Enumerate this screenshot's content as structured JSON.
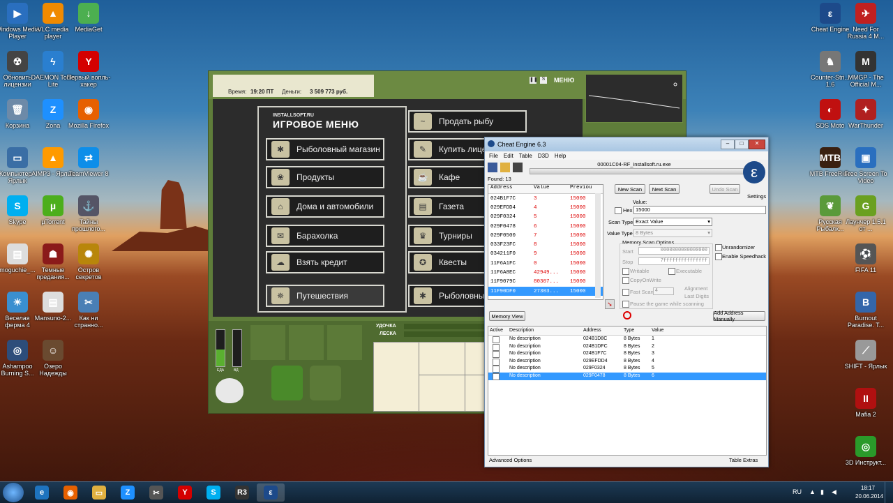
{
  "desktop": {
    "left_icons": [
      {
        "label": "Windows Media Player",
        "glyph": "▶",
        "color": "#2a6fbf",
        "icon": "media-player-icon"
      },
      {
        "label": "VLC media player",
        "glyph": "▲",
        "color": "#f08a00",
        "icon": "vlc-icon"
      },
      {
        "label": "MediaGet",
        "glyph": "↓",
        "color": "#4caf50",
        "icon": "mediaget-icon"
      },
      {
        "label": "Обновить лицензии",
        "glyph": "☢",
        "color": "#444",
        "icon": "update-icon"
      },
      {
        "label": "DAEMON Tools Lite",
        "glyph": "ϟ",
        "color": "#2a7fd0",
        "icon": "daemon-icon"
      },
      {
        "label": "Первый вопль-хакер",
        "glyph": "Y",
        "color": "#d40000",
        "icon": "yandex-icon"
      },
      {
        "label": "Корзина",
        "glyph": "🗑",
        "color": "#6d8aa8",
        "icon": "recycle-bin-icon"
      },
      {
        "label": "Zona",
        "glyph": "Z",
        "color": "#1e90ff",
        "icon": "zona-icon"
      },
      {
        "label": "Mozilla Firefox",
        "glyph": "◉",
        "color": "#e66000",
        "icon": "firefox-icon"
      },
      {
        "label": "Компьютер - Ярлык",
        "glyph": "▭",
        "color": "#3a6ea5",
        "icon": "computer-icon"
      },
      {
        "label": "AIMP3 - Ярлык",
        "glyph": "▲",
        "color": "#ff9a00",
        "icon": "aimp-icon"
      },
      {
        "label": "TeamViewer 8",
        "glyph": "⇄",
        "color": "#0e8ee9",
        "icon": "teamviewer-icon"
      },
      {
        "label": "Skype",
        "glyph": "S",
        "color": "#00aff0",
        "icon": "skype-icon"
      },
      {
        "label": "µTorrent",
        "glyph": "µ",
        "color": "#4cae1c",
        "icon": "utorrent-icon"
      },
      {
        "label": "Тайны прошлого...",
        "glyph": "⚓",
        "color": "#556",
        "icon": "game-icon"
      },
      {
        "label": "moguchie_...",
        "glyph": "▤",
        "color": "#ddd",
        "icon": "document-icon"
      },
      {
        "label": "Темные предания...",
        "glyph": "☗",
        "color": "#8b1a1a",
        "icon": "game-icon"
      },
      {
        "label": "Остров секретов",
        "glyph": "✺",
        "color": "#b8860b",
        "icon": "game-icon"
      },
      {
        "label": "Веселая ферма 4",
        "glyph": "☀",
        "color": "#3a8fd0",
        "icon": "game-icon"
      },
      {
        "label": "Mansuno-2...",
        "glyph": "▤",
        "color": "#ddd",
        "icon": "document-icon"
      },
      {
        "label": "Как ни странно...",
        "glyph": "✂",
        "color": "#4a7fb5",
        "icon": "game-icon"
      },
      {
        "label": "Ashampoo Burning S...",
        "glyph": "◎",
        "color": "#2d4d7a",
        "icon": "ashampoo-icon"
      },
      {
        "label": "Озеро Надежды",
        "glyph": "☺",
        "color": "#6a4a30",
        "icon": "game-icon"
      }
    ],
    "right_icons": [
      {
        "label": "Cheat Engine",
        "glyph": "ε",
        "color": "#1d4a8a",
        "icon": "cheat-engine-icon"
      },
      {
        "label": "Need For Russia 4 M...",
        "glyph": "✈",
        "color": "#c02020",
        "icon": "game-icon"
      },
      {
        "label": "Counter-Stri... 1.6",
        "glyph": "♞",
        "color": "#777",
        "icon": "counter-strike-icon"
      },
      {
        "label": "MMGP - The Official M...",
        "glyph": "M",
        "color": "#333",
        "icon": "game-icon"
      },
      {
        "label": "SDS Moto",
        "glyph": "◐",
        "color": "#c01010",
        "icon": "game-icon"
      },
      {
        "label": "WarThunder",
        "glyph": "✦",
        "color": "#b02020",
        "icon": "warthunder-icon"
      },
      {
        "label": "MTB FreeRide",
        "glyph": "MTB",
        "color": "#3a2010",
        "icon": "game-icon"
      },
      {
        "label": "Free Screen To Video",
        "glyph": "▣",
        "color": "#2a6fbf",
        "icon": "screen-video-icon"
      },
      {
        "label": "Русская Рыбалк...",
        "glyph": "❦",
        "color": "#5a9a3a",
        "icon": "fishing-icon"
      },
      {
        "label": "Лаунчер 1.5.1 от ...",
        "glyph": "G",
        "color": "#6aa020",
        "icon": "launcher-icon"
      },
      {
        "label": "FIFA 11",
        "glyph": "⚽",
        "color": "#555",
        "icon": "fifa-icon"
      },
      {
        "label": "Burnout Paradise. T...",
        "glyph": "B",
        "color": "#3366aa",
        "icon": "game-icon"
      },
      {
        "label": "SHIFT - Ярлык",
        "glyph": "⟋",
        "color": "#999",
        "icon": "shift-icon"
      },
      {
        "label": "Mafia 2",
        "glyph": "II",
        "color": "#b01010",
        "icon": "mafia-icon"
      },
      {
        "label": "3D Инструкт...",
        "glyph": "◎",
        "color": "#2a9a2a",
        "icon": "game-icon"
      }
    ]
  },
  "game": {
    "time_label": "Время:",
    "time_value": "19:20 ПТ",
    "money_label": "Деньги:",
    "money_value": "3 509 773 руб.",
    "menu_label": "МЕНЮ",
    "logo_small": "INSTALLSOFT.RU",
    "logo_big": "ИГРОВОЕ МЕНЮ",
    "left_buttons": [
      "Рыболовный магазин",
      "Продукты",
      "Дома и автомобили",
      "Барахолка",
      "Взять кредит",
      "Путешествия"
    ],
    "right_buttons": [
      "Продать рыбу",
      "Купить лицензию",
      "Кафе",
      "Газета",
      "Турниры",
      "Квесты",
      "Рыболовные"
    ],
    "bar_labels": {
      "eda": "ЕДА",
      "vd": "ВД",
      "udochka": "УДОЧКА",
      "leska": "ЛЕСКА"
    }
  },
  "ce": {
    "title": "Cheat Engine 6.3",
    "menu": [
      "File",
      "Edit",
      "Table",
      "D3D",
      "Help"
    ],
    "process": "00001C04-RF_installsoft.ru.exe",
    "found": "Found: 13",
    "columns": [
      "Address",
      "Value",
      "Previou"
    ],
    "rows": [
      {
        "address": "024B1F7C",
        "value": "3",
        "previous": "15000"
      },
      {
        "address": "029EFDD4",
        "value": "4",
        "previous": "15000"
      },
      {
        "address": "029F0324",
        "value": "5",
        "previous": "15000"
      },
      {
        "address": "029F0478",
        "value": "6",
        "previous": "15000"
      },
      {
        "address": "029F0500",
        "value": "7",
        "previous": "15000"
      },
      {
        "address": "033F23FC",
        "value": "8",
        "previous": "15000"
      },
      {
        "address": "034211F0",
        "value": "9",
        "previous": "15000"
      },
      {
        "address": "11F6A1FC",
        "value": "0",
        "previous": "15000"
      },
      {
        "address": "11F6A8EC",
        "value": "42949...",
        "previous": "15000"
      },
      {
        "address": "11F9079C",
        "value": "80307...",
        "previous": "15000"
      },
      {
        "address": "11F90DF0",
        "value": "27303...",
        "previous": "15000"
      }
    ],
    "new_scan": "New Scan",
    "next_scan": "Next Scan",
    "undo_scan": "Undo Scan",
    "settings": "Settings",
    "value_label": "Value:",
    "hex_label": "Hex",
    "value_input": "15000",
    "scan_type_label": "Scan Type",
    "scan_type": "Exact Value",
    "value_type_label": "Value Type",
    "value_type": "8 Bytes",
    "memory_options": "Memory Scan Options",
    "start_label": "Start",
    "start_value": "0000000000000000",
    "stop_label": "Stop",
    "stop_value": "7fffffffffffffff",
    "writable": "Writable",
    "executable": "Executable",
    "copyonwrite": "CopyOnWrite",
    "fast_scan": "Fast Scan",
    "fast_scan_value": "4",
    "alignment": "Alignment",
    "last_digits": "Last Digits",
    "pause_game": "Pause the game while scanning",
    "unrandomizer": "Unrandomizer",
    "speedhack": "Enable Speedhack",
    "memory_view": "Memory View",
    "add_manual": "Add Address Manually",
    "table_columns": [
      "Active",
      "Description",
      "Address",
      "Type",
      "Value"
    ],
    "table_rows": [
      {
        "desc": "No description",
        "address": "024B1D8C",
        "type": "8 Bytes",
        "value": "1"
      },
      {
        "desc": "No description",
        "address": "024B1DFC",
        "type": "8 Bytes",
        "value": "2"
      },
      {
        "desc": "No description",
        "address": "024B1F7C",
        "type": "8 Bytes",
        "value": "3"
      },
      {
        "desc": "No description",
        "address": "029EFDD4",
        "type": "8 Bytes",
        "value": "4"
      },
      {
        "desc": "No description",
        "address": "029F0324",
        "type": "8 Bytes",
        "value": "5"
      },
      {
        "desc": "No description",
        "address": "029F0478",
        "type": "8 Bytes",
        "value": "6"
      }
    ],
    "advanced": "Advanced Options",
    "table_extras": "Table Extras"
  },
  "taskbar": {
    "items": [
      {
        "glyph": "e",
        "color": "#1e73be",
        "icon": "ie-icon"
      },
      {
        "glyph": "◉",
        "color": "#e66000",
        "icon": "firefox-icon"
      },
      {
        "glyph": "▭",
        "color": "#e0b040",
        "icon": "explorer-icon"
      },
      {
        "glyph": "Z",
        "color": "#1e90ff",
        "icon": "zona-icon"
      },
      {
        "glyph": "✂",
        "color": "#555",
        "icon": "tool-icon"
      },
      {
        "glyph": "Y",
        "color": "#d40000",
        "icon": "yandex-icon"
      },
      {
        "glyph": "S",
        "color": "#00aff0",
        "icon": "skype-icon"
      },
      {
        "glyph": "R3",
        "color": "#333",
        "icon": "game-icon"
      },
      {
        "glyph": "ε",
        "color": "#1d4a8a",
        "icon": "cheat-engine-icon"
      }
    ],
    "lang": "RU",
    "time": "18:17",
    "date": "20.06.2014"
  }
}
